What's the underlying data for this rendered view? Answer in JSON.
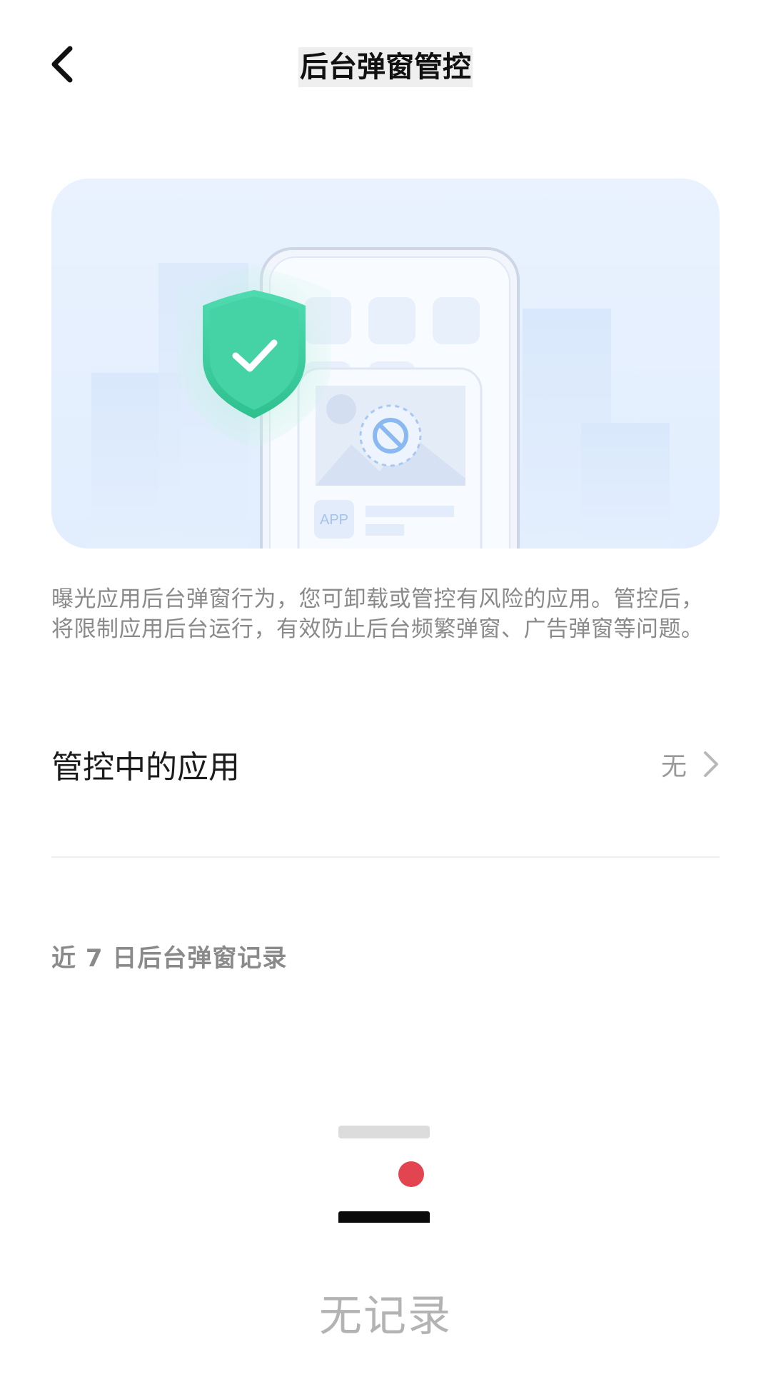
{
  "header": {
    "title": "后台弹窗管控",
    "back_icon": "chevron-left-icon"
  },
  "banner": {
    "app_label": "APP",
    "shield_icon": "shield-check-icon",
    "block_icon": "no-entry-icon",
    "colors": {
      "shield": "#3cc89c",
      "background": "#e6f0fe",
      "block": "#8ab8f0"
    }
  },
  "description": "曝光应用后台弹窗行为，您可卸载或管控有风险的应用。管控后，将限制应用后台运行，有效防止后台频繁弹窗、广告弹窗等问题。",
  "managed_apps": {
    "label": "管控中的应用",
    "value": "无",
    "chevron_icon": "chevron-right-icon"
  },
  "records": {
    "title": "近 7 日后台弹窗记录",
    "empty_text": "无记录",
    "empty_icon": "empty-record-icon",
    "accent_color": "#e24550"
  }
}
